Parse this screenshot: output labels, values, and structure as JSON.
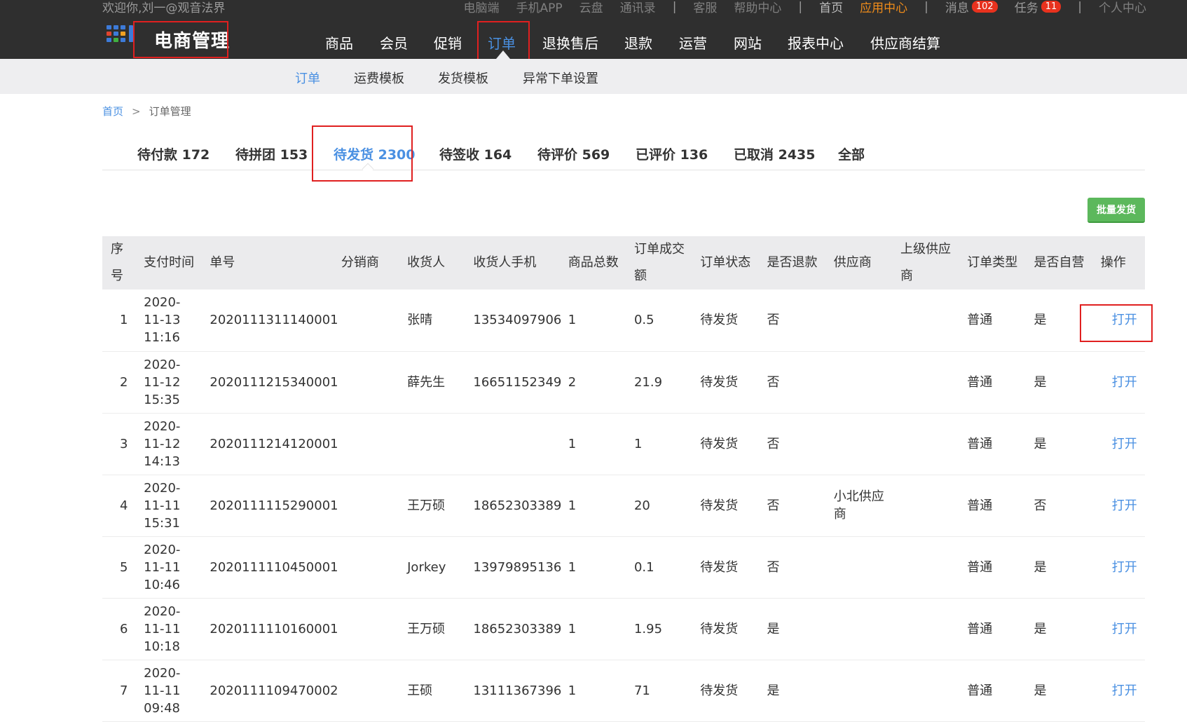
{
  "header": {
    "welcome": "欢迎你,刘一@观音法界",
    "top_links": {
      "pc": "电脑端",
      "app": "手机APP",
      "cloud": "云盘",
      "contacts": "通讯录",
      "sep1": "|",
      "service": "客服",
      "help": "帮助中心",
      "sep2": "|",
      "home": "首页",
      "app_center": "应用中心",
      "sep3": "|",
      "messages": "消息",
      "messages_count": "102",
      "tasks": "任务",
      "tasks_count": "11",
      "sep4": "|",
      "profile": "个人中心"
    },
    "brand": "电商管理",
    "nav": {
      "goods": "商品",
      "members": "会员",
      "promo": "促销",
      "orders": "订单",
      "returns": "退换售后",
      "refunds": "退款",
      "operations": "运营",
      "website": "网站",
      "reports": "报表中心",
      "supplier_settlement": "供应商结算"
    },
    "active_nav": "订单"
  },
  "subnav": {
    "orders": "订单",
    "freight_template": "运费模板",
    "shipping_template": "发货模板",
    "abnormal_order_settings": "异常下单设置"
  },
  "breadcrumb": {
    "home": "首页",
    "sep": ">",
    "current": "订单管理"
  },
  "tabs": {
    "pending_payment": "待付款 172",
    "pending_group": "待拼团 153",
    "pending_shipment": "待发货 2300",
    "pending_receipt": "待签收 164",
    "pending_review": "待评价 569",
    "reviewed": "已评价 136",
    "cancelled": "已取消 2435",
    "all": "全部"
  },
  "batch_ship_button": "批量发货",
  "table": {
    "headers": {
      "idx": "序号",
      "pay_time": "支付时间",
      "order_no": "单号",
      "distributor": "分销商",
      "receiver": "收货人",
      "receiver_phone": "收货人手机",
      "total_qty": "商品总数",
      "amount_l1": "订单成交",
      "amount_l2": "额",
      "status": "订单状态",
      "refunded": "是否退款",
      "supplier": "供应商",
      "parent_supplier_l1": "上级供应",
      "parent_supplier_l2": "商",
      "order_type": "订单类型",
      "self_operated": "是否自营",
      "action": "操作"
    },
    "rows": [
      {
        "idx": "1",
        "date": "2020-",
        "date2": "11-13",
        "time": "11:16",
        "order_no": "2020111311140001",
        "distributor": "",
        "receiver": "张晴",
        "phone": "13534097906",
        "qty": "1",
        "amount": "0.5",
        "status": "待发货",
        "refunded": "否",
        "supplier": "",
        "supplier2": "",
        "parent_supplier": "",
        "type": "普通",
        "self": "是",
        "action": "打开"
      },
      {
        "idx": "2",
        "date": "2020-",
        "date2": "11-12",
        "time": "15:35",
        "order_no": "2020111215340001",
        "distributor": "",
        "receiver": "薛先生",
        "phone": "16651152349",
        "qty": "2",
        "amount": "21.9",
        "status": "待发货",
        "refunded": "否",
        "supplier": "",
        "supplier2": "",
        "parent_supplier": "",
        "type": "普通",
        "self": "是",
        "action": "打开"
      },
      {
        "idx": "3",
        "date": "2020-",
        "date2": "11-12",
        "time": "14:13",
        "order_no": "2020111214120001",
        "distributor": "",
        "receiver": "",
        "phone": "",
        "qty": "1",
        "amount": "1",
        "status": "待发货",
        "refunded": "否",
        "supplier": "",
        "supplier2": "",
        "parent_supplier": "",
        "type": "普通",
        "self": "是",
        "action": "打开"
      },
      {
        "idx": "4",
        "date": "2020-",
        "date2": "11-11",
        "time": "15:31",
        "order_no": "2020111115290001",
        "distributor": "",
        "receiver": "王万硕",
        "phone": "18652303389",
        "qty": "1",
        "amount": "20",
        "status": "待发货",
        "refunded": "否",
        "supplier": "小北供应",
        "supplier2": "商",
        "parent_supplier": "",
        "type": "普通",
        "self": "否",
        "action": "打开"
      },
      {
        "idx": "5",
        "date": "2020-",
        "date2": "11-11",
        "time": "10:46",
        "order_no": "2020111110450001",
        "distributor": "",
        "receiver": "Jorkey",
        "phone": "13979895136",
        "qty": "1",
        "amount": "0.1",
        "status": "待发货",
        "refunded": "否",
        "supplier": "",
        "supplier2": "",
        "parent_supplier": "",
        "type": "普通",
        "self": "是",
        "action": "打开"
      },
      {
        "idx": "6",
        "date": "2020-",
        "date2": "11-11",
        "time": "10:18",
        "order_no": "2020111110160001",
        "distributor": "",
        "receiver": "王万硕",
        "phone": "18652303389",
        "qty": "1",
        "amount": "1.95",
        "status": "待发货",
        "refunded": "是",
        "supplier": "",
        "supplier2": "",
        "parent_supplier": "",
        "type": "普通",
        "self": "是",
        "action": "打开"
      },
      {
        "idx": "7",
        "date": "2020-",
        "date2": "11-11",
        "time": "09:48",
        "order_no": "2020111109470002",
        "distributor": "",
        "receiver": "王硕",
        "phone": "13111367396",
        "qty": "1",
        "amount": "71",
        "status": "待发货",
        "refunded": "是",
        "supplier": "",
        "supplier2": "",
        "parent_supplier": "",
        "type": "普通",
        "self": "是",
        "action": "打开"
      }
    ]
  },
  "colors": {
    "header_bg": "#2f2f2f",
    "accent": "#4a90e2",
    "highlight_box": "#e02020",
    "app_center": "#f08c1a",
    "batch_button": "#5cb85c",
    "badge": "#e8321e"
  }
}
